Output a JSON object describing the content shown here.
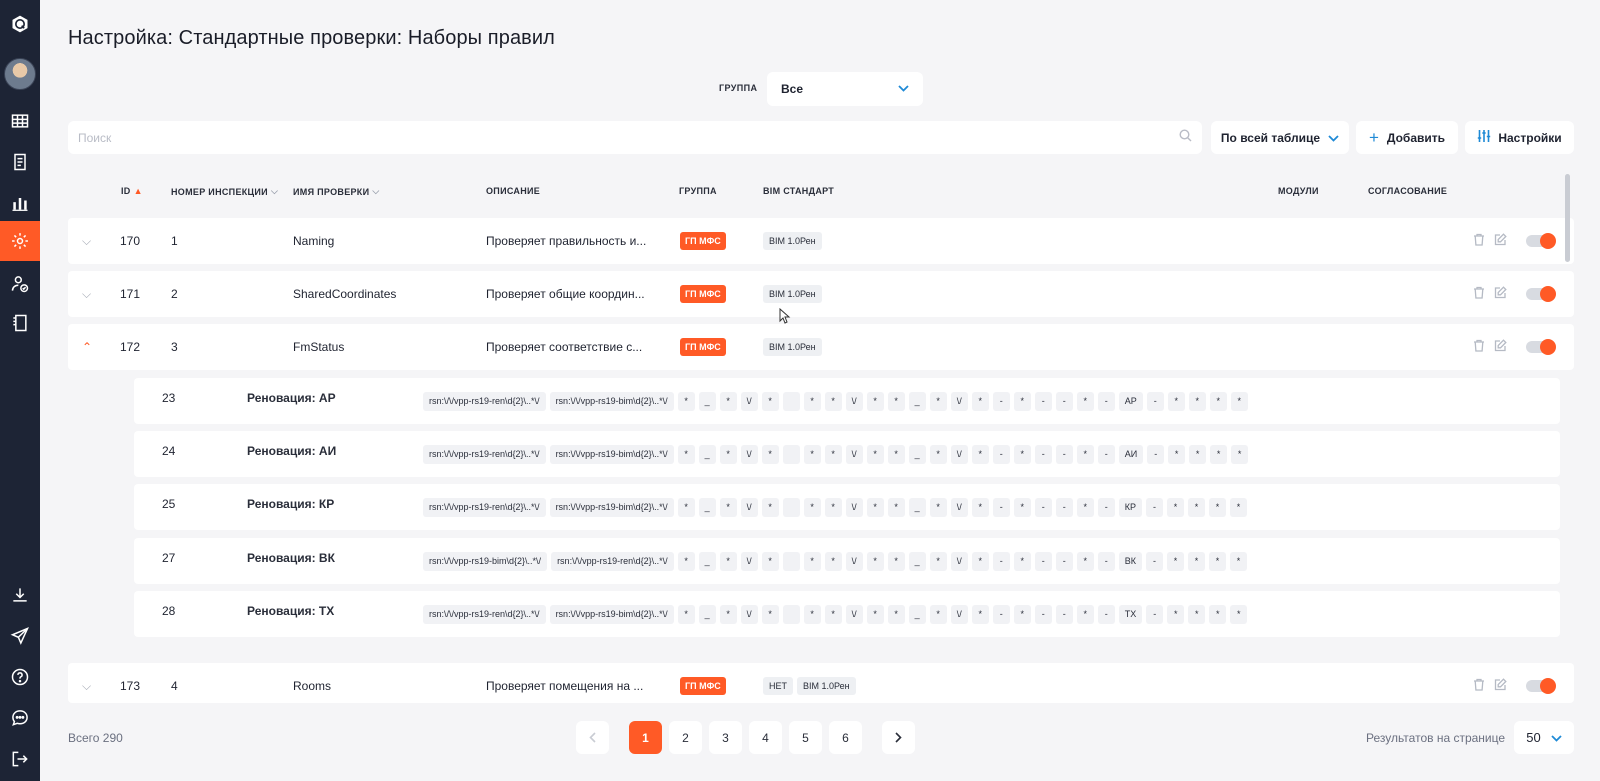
{
  "page": {
    "title": "Настройка: Стандартные проверки: Наборы правил"
  },
  "filter": {
    "group_label": "ГРУППА",
    "group_value": "Все"
  },
  "search": {
    "placeholder": "Поиск"
  },
  "toolbar": {
    "scope_label": "По всей таблице",
    "add_label": "Добавить",
    "settings_label": "Настройки"
  },
  "columns": {
    "id": "ID",
    "inspection": "НОМЕР ИНСПЕКЦИИ",
    "name": "ИМЯ ПРОВЕРКИ",
    "description": "ОПИСАНИЕ",
    "group": "ГРУППА",
    "bim": "BIM СТАНДАРТ",
    "modules": "МОДУЛИ",
    "approval": "СОГЛАСОВАНИЕ"
  },
  "rows": [
    {
      "id": "170",
      "num": "1",
      "name": "Naming",
      "desc": "Проверяет правильность и...",
      "group": "ГП МФС",
      "bim": [
        "BIM 1.0Рен"
      ],
      "expanded": false
    },
    {
      "id": "171",
      "num": "2",
      "name": "SharedCoordinates",
      "desc": "Проверяет общие координ...",
      "group": "ГП МФС",
      "bim": [
        "BIM 1.0Рен"
      ],
      "expanded": false
    },
    {
      "id": "172",
      "num": "3",
      "name": "FmStatus",
      "desc": "Проверяет соответствие с...",
      "group": "ГП МФС",
      "bim": [
        "BIM 1.0Рен"
      ],
      "expanded": true
    },
    {
      "id": "173",
      "num": "4",
      "name": "Rooms",
      "desc": "Проверяет помещения на ...",
      "group": "ГП МФС",
      "bim": [
        "НЕТ",
        "BIM 1.0Рен"
      ],
      "expanded": false
    }
  ],
  "subrows": [
    {
      "id": "23",
      "name": "Реновация: АР",
      "p1": "rsn:\\/\\/vpp-rs19-ren\\d{2}\\..*\\/",
      "p2": "rsn:\\/\\/vpp-rs19-bim\\d{2}\\..*\\/",
      "code": "АР"
    },
    {
      "id": "24",
      "name": "Реновация: АИ",
      "p1": "rsn:\\/\\/vpp-rs19-ren\\d{2}\\..*\\/",
      "p2": "rsn:\\/\\/vpp-rs19-bim\\d{2}\\..*\\/",
      "code": "АИ"
    },
    {
      "id": "25",
      "name": "Реновация: КР",
      "p1": "rsn:\\/\\/vpp-rs19-ren\\d{2}\\..*\\/",
      "p2": "rsn:\\/\\/vpp-rs19-bim\\d{2}\\..*\\/",
      "code": "КР"
    },
    {
      "id": "27",
      "name": "Реновация: ВК",
      "p1": "rsn:\\/\\/vpp-rs19-bim\\d{2}\\..*\\/",
      "p2": "rsn:\\/\\/vpp-rs19-ren\\d{2}\\..*\\/",
      "code": "ВК"
    },
    {
      "id": "28",
      "name": "Реновация: ТХ",
      "p1": "rsn:\\/\\/vpp-rs19-ren\\d{2}\\..*\\/",
      "p2": "rsn:\\/\\/vpp-rs19-bim\\d{2}\\..*\\/",
      "code": "ТХ"
    }
  ],
  "subrow_symbols": [
    "*",
    "_",
    "*",
    "\\/",
    "*",
    "",
    "*",
    "*",
    "\\/",
    "*",
    "*",
    "_",
    "*",
    "\\/",
    "*",
    "-",
    "*",
    "-",
    "-",
    "*",
    "-"
  ],
  "subrow_tail": [
    "-",
    "*",
    "*",
    "*",
    "*"
  ],
  "footer": {
    "total": "Всего 290",
    "pages": [
      "1",
      "2",
      "3",
      "4",
      "5",
      "6"
    ],
    "per_page_label": "Результатов на странице",
    "per_page_value": "50"
  },
  "colors": {
    "accent": "#ff5a26",
    "sidebar": "#1d2435",
    "link": "#1f8ad6"
  }
}
